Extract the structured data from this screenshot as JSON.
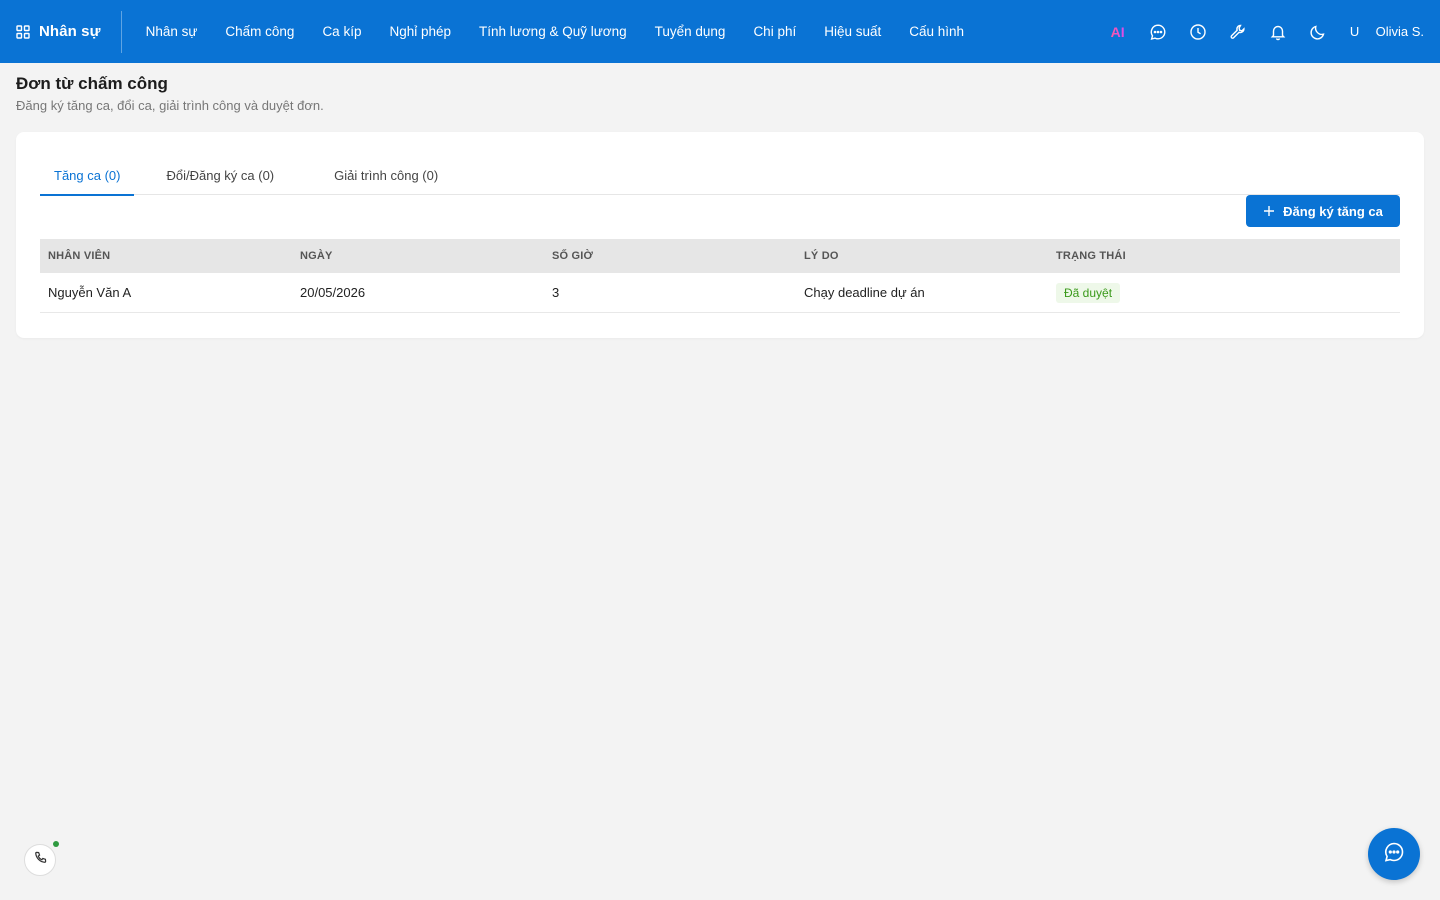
{
  "app": {
    "brand_name": "Nhân sự",
    "brand_icon": "apps-grid-icon"
  },
  "nav": {
    "items": [
      {
        "label": "Nhân sự"
      },
      {
        "label": "Chấm công"
      },
      {
        "label": "Ca kíp"
      },
      {
        "label": "Nghỉ phép"
      },
      {
        "label": "Tính lương & Quỹ lương"
      },
      {
        "label": "Tuyển dụng"
      },
      {
        "label": "Chi phí"
      },
      {
        "label": "Hiệu suất"
      },
      {
        "label": "Cấu hình"
      }
    ]
  },
  "top_actions": {
    "ai_label": "AI",
    "icons": [
      "chat-icon",
      "clock-icon",
      "wrench-icon",
      "bell-icon",
      "moon-icon"
    ],
    "avatar_initial": "U",
    "user_name": "Olivia S."
  },
  "page": {
    "title": "Đơn từ chấm công",
    "subtitle": "Đăng ký tăng ca, đổi ca, giải trình công và duyệt đơn."
  },
  "tabs": [
    {
      "label": "Tăng ca (0)",
      "active": true
    },
    {
      "label": "Đổi/Đăng ký ca (0)",
      "active": false
    },
    {
      "label": "Giải trình công (0)",
      "active": false
    }
  ],
  "actions": {
    "add_label": "Đăng ký tăng ca"
  },
  "table": {
    "columns": [
      "NHÂN VIÊN",
      "NGÀY",
      "SỐ GIỜ",
      "LÝ DO",
      "TRẠNG THÁI"
    ],
    "rows": [
      {
        "employee": "Nguyễn Văn A",
        "date": "20/05/2026",
        "hours": "3",
        "reason": "Chạy deadline dự án",
        "status": "Đã duyệt"
      }
    ]
  },
  "colors": {
    "primary": "#0a73d4",
    "status_approved_bg": "#eef8e9",
    "status_approved_text": "#3a9a1a",
    "online": "#2e9a3f"
  }
}
